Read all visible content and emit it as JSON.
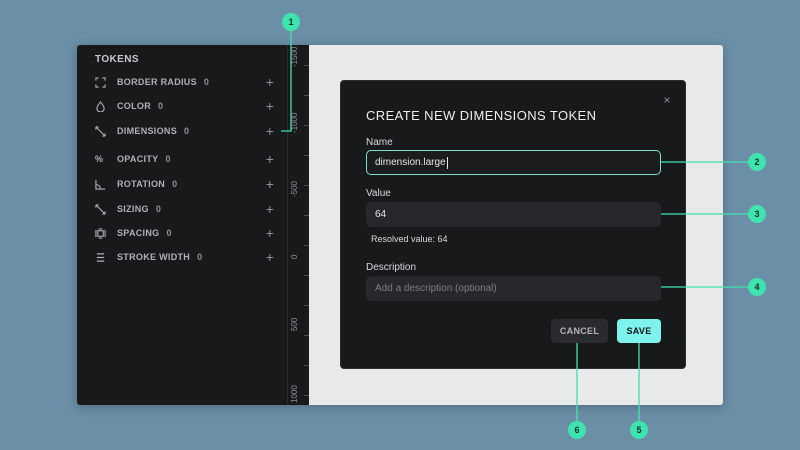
{
  "sidebar": {
    "title": "TOKENS",
    "items": [
      {
        "icon": "border-radius-icon",
        "label": "BORDER RADIUS",
        "count": "0",
        "add": "+"
      },
      {
        "icon": "color-drop-icon",
        "label": "COLOR",
        "count": "0",
        "add": "+"
      },
      {
        "icon": "dimensions-arrow-icon",
        "label": "DIMENSIONS",
        "count": "0",
        "add": "+"
      },
      {
        "icon": "percent-icon",
        "label": "OPACITY",
        "count": "0",
        "add": "+",
        "glyph": "%"
      },
      {
        "icon": "rotation-angle-icon",
        "label": "ROTATION",
        "count": "0",
        "add": "+"
      },
      {
        "icon": "sizing-arrow-icon",
        "label": "SIZING",
        "count": "0",
        "add": "+"
      },
      {
        "icon": "spacing-icon",
        "label": "SPACING",
        "count": "0",
        "add": "+"
      },
      {
        "icon": "stroke-width-icon",
        "label": "STROKE WIDTH",
        "count": "0",
        "add": "+"
      }
    ]
  },
  "ruler": {
    "labels": [
      "-1500",
      "-1000",
      "-500",
      "0",
      "500",
      "1000"
    ]
  },
  "modal": {
    "title": "CREATE NEW DIMENSIONS TOKEN",
    "close_glyph": "×",
    "name_label": "Name",
    "name_value": "dimension.large",
    "value_label": "Value",
    "value_value": "64",
    "resolved_text": "Resolved value: 64",
    "description_label": "Description",
    "description_placeholder": "Add a description (optional)",
    "cancel_label": "CANCEL",
    "save_label": "SAVE"
  },
  "annotations": [
    "1",
    "2",
    "3",
    "4",
    "5",
    "6"
  ],
  "colors": {
    "background": "#6b8fa6",
    "panel": "#18191b",
    "accent_focus": "#7ee0c8",
    "save_button": "#7ef2ec",
    "badge": "#3fe3b0"
  }
}
